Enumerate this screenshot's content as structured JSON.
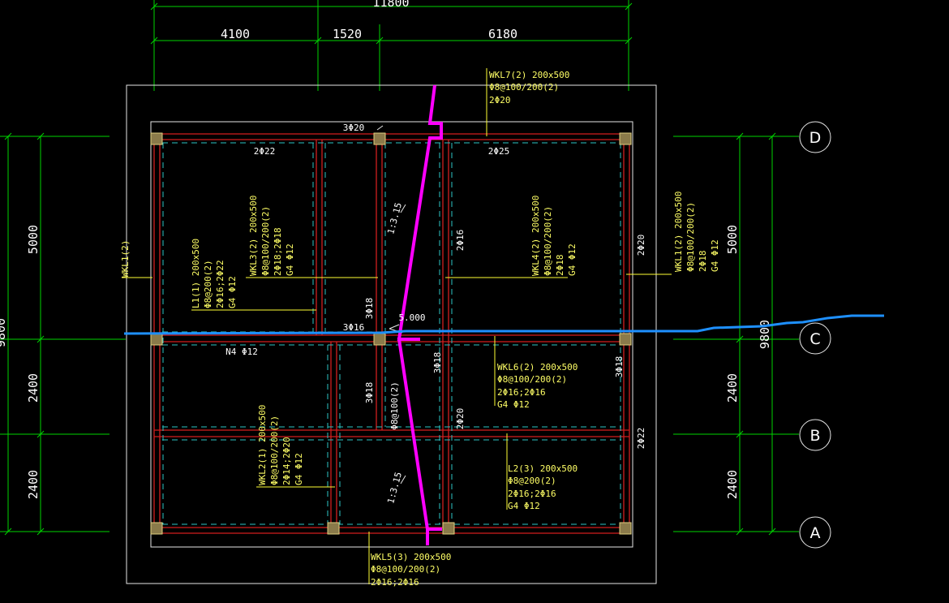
{
  "dimensions": {
    "top_total": "11800",
    "top_segments": [
      "4100",
      "1520",
      "6180"
    ],
    "left_total_partial": "9800",
    "left_segments": [
      "5000",
      "2400",
      "2400"
    ],
    "right_total": "9800",
    "right_segments": [
      "5000",
      "2400",
      "2400"
    ]
  },
  "axes": [
    "D",
    "C",
    "B",
    "A"
  ],
  "beams": {
    "wkl7": [
      "WKL7(2) 200x500",
      "Φ8@100/200(2)",
      "2Φ20"
    ],
    "wkl3": [
      "WKL3(2) 200x500",
      "Φ8@100/200(2)",
      "2Φ18;2Φ18",
      "G4 Φ12"
    ],
    "l1": [
      "L1(1) 200x500",
      "Φ8@200(2)",
      "2Φ16;2Φ22",
      "G4 Φ12"
    ],
    "wkl4": [
      "WKL4(2) 200x500",
      "Φ8@100/200(2)",
      "2Φ18",
      "G4 Φ12"
    ],
    "wkl1": [
      "WKL1(2) 200x500",
      "Φ8@100/200(2)",
      "2Φ18",
      "G4 Φ12"
    ],
    "wkl6": [
      "WKL6(2) 200x500",
      "Φ8@100/200(2)",
      "2Φ16;2Φ16",
      "G4 Φ12"
    ],
    "wkl2": [
      "WKL2(1) 200x500",
      "Φ8@100/200(2)",
      "2Φ14;2Φ20",
      "G4 Φ12"
    ],
    "l2": [
      "L2(3) 200x500",
      "Φ8@200(2)",
      "2Φ16;2Φ16",
      "G4 Φ12"
    ],
    "wkl5": [
      "WKL5(3) 200x500",
      "Φ8@100/200(2)",
      "2Φ16;2Φ16"
    ],
    "wkl1_left": "WKL1(2)"
  },
  "rebar_marks": {
    "top_3phi20": "3Φ20",
    "phi22_top": "2Φ22",
    "phi25_top": "2Φ25",
    "phi16_mid": "2Φ16",
    "phi20_right": "2Φ20",
    "phi18_v1": "3Φ18",
    "phi16_c": "3Φ16",
    "n4": "N4 Φ12",
    "phi18_v2": "3Φ18",
    "phi18_v3": "3Φ18",
    "phi18_v4": "3Φ18",
    "phi8_v": "Φ8@100(2)",
    "phi20_v": "2Φ20",
    "phi22_right": "2Φ22",
    "slope_top": "1:3.15",
    "slope_bottom": "1:3.15",
    "elevation": "5.000"
  },
  "colors": {
    "background": "#000000",
    "dimension_lines": "#00d400",
    "beam_lines": "#d21e1e",
    "section_cut": "#ff00ff",
    "blue_polyline": "#1e90ff",
    "annotation": "#ffff66"
  }
}
